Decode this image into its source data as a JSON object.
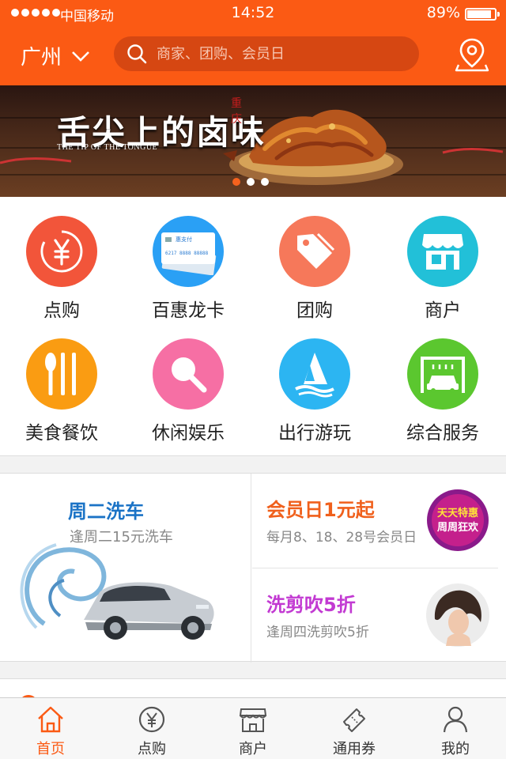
{
  "status_bar": {
    "carrier": "中国移动",
    "time": "14:52",
    "battery": "89%",
    "battery_level": 0.89
  },
  "header": {
    "city": "广州",
    "search_placeholder": "商家、团购、会员日",
    "icons": [
      "chevron-down-icon",
      "search-icon",
      "location-pin-icon"
    ]
  },
  "banner": {
    "title": "舌尖上的卤味",
    "subtitle": "THE TIP OF THE TONGUE",
    "seal": "重庆",
    "slide_count": 3,
    "active_slide": 1
  },
  "categories": [
    {
      "label": "点购",
      "icon": "yen-coin-icon",
      "color": "#f2553a"
    },
    {
      "label": "百惠龙卡",
      "icon": "bank-card-icon",
      "color": "#2aa0f5",
      "card_text": "惠支付",
      "card_number": "6217 8888 88888"
    },
    {
      "label": "团购",
      "icon": "price-tag-icon",
      "color": "#f6785a"
    },
    {
      "label": "商户",
      "icon": "storefront-icon",
      "color": "#22c0d8"
    },
    {
      "label": "美食餐饮",
      "icon": "fork-knife-icon",
      "color": "#fa9c12"
    },
    {
      "label": "休闲娱乐",
      "icon": "microphone-icon",
      "color": "#f66fa4"
    },
    {
      "label": "出行游玩",
      "icon": "sailboat-icon",
      "color": "#2cb5f2"
    },
    {
      "label": "综合服务",
      "icon": "car-wash-icon",
      "color": "#5bc72f"
    }
  ],
  "promos": {
    "car_wash": {
      "title": "周二洗车",
      "subtitle": "逢周二15元洗车",
      "title_color": "#1b73c6"
    },
    "member_day": {
      "title": "会员日1元起",
      "subtitle": "每月8、18、28号会员日",
      "title_color": "#f0601c",
      "badge_line1": "天天特惠",
      "badge_line2": "周周狂欢"
    },
    "haircut": {
      "title": "洗剪吹5折",
      "subtitle": "逢周四洗剪吹5折",
      "title_color": "#c23ad2"
    }
  },
  "tabbar": {
    "tabs": [
      {
        "label": "首页",
        "icon": "home-icon",
        "active": true
      },
      {
        "label": "点购",
        "icon": "yen-circle-icon",
        "active": false
      },
      {
        "label": "商户",
        "icon": "shop-icon",
        "active": false
      },
      {
        "label": "通用券",
        "icon": "ticket-icon",
        "active": false
      },
      {
        "label": "我的",
        "icon": "person-icon",
        "active": false
      }
    ],
    "accent": "#fb5a14"
  }
}
